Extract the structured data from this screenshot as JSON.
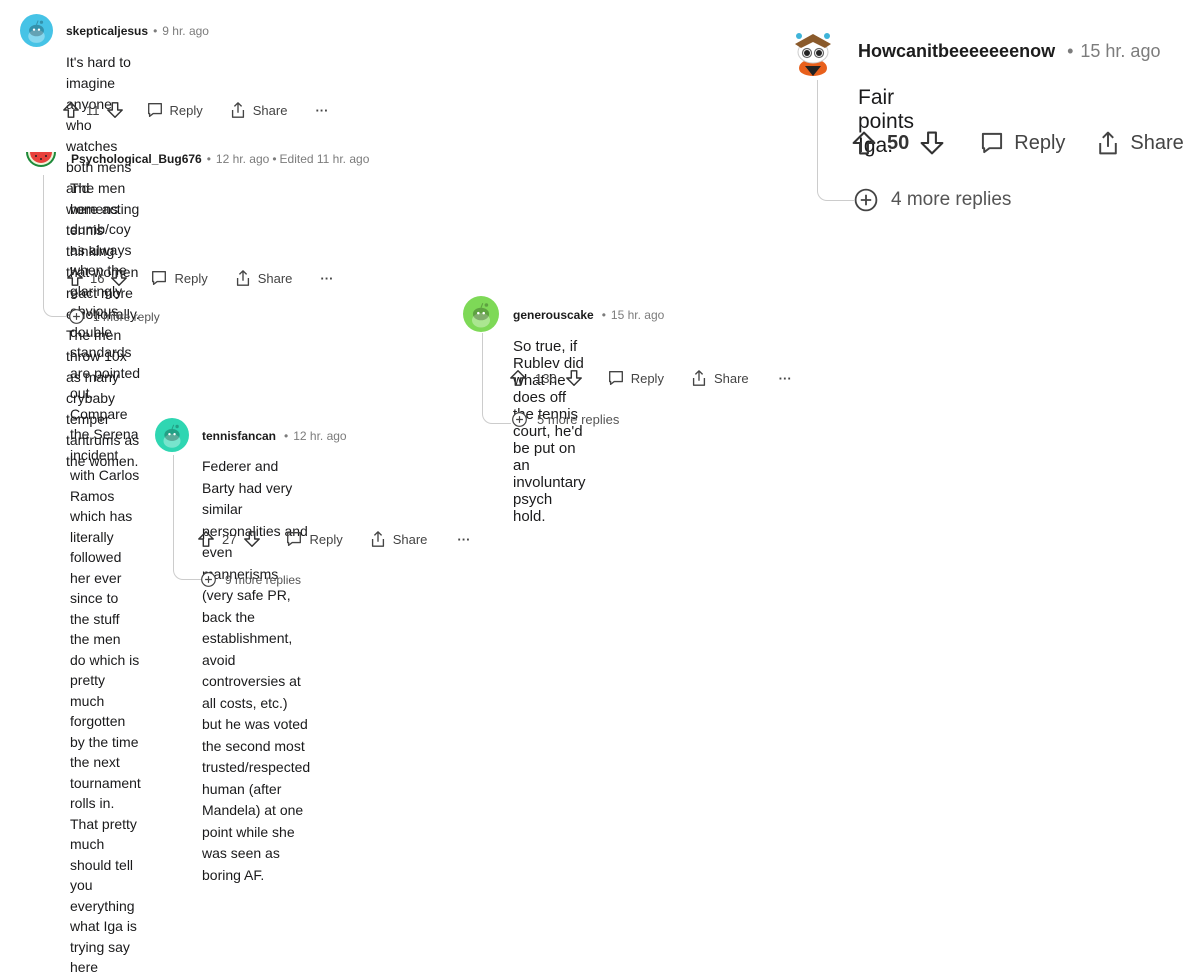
{
  "comments": {
    "c1": {
      "username": "skepticaljesus",
      "time": "9 hr. ago",
      "body_lines": [
        "It's hard to imagine anyone who watches both mens and womens tennis thinking that women react more",
        "emotionally. The men throw 10x as many crybaby temper tantrums as the women."
      ],
      "votes": "11",
      "reply_label": "Reply",
      "share_label": "Share",
      "more_label": "···",
      "avatar_color": "#46c3e6"
    },
    "c2": {
      "username": "Psychological_Bug676",
      "time": "12 hr. ago",
      "edited": "Edited 11 hr. ago",
      "body_lines": [
        "The men here acting dumb/coy as always when the glaringly obvious double standards are pointed out.",
        "Compare the Serena incident with Carlos Ramos which has literally followed her ever since to the stuff the men",
        "do which is pretty much forgotten by the time the next tournament rolls in. That pretty much should tell you",
        "everything what Iga is trying say here"
      ],
      "votes": "16",
      "reply_label": "Reply",
      "share_label": "Share",
      "more_label": "···",
      "more_replies": "1 more reply"
    },
    "c3": {
      "username": "Howcanitbeeeeeeenow",
      "time": "15 hr. ago",
      "body": "Fair points Iga.",
      "votes": "50",
      "reply_label": "Reply",
      "share_label": "Share",
      "more_replies": "4 more replies"
    },
    "c4": {
      "username": "generouscake",
      "time": "15 hr. ago",
      "body": "So true, if Rublev did what he does off the tennis court, he'd be put on an involuntary psych hold.",
      "votes": "130",
      "reply_label": "Reply",
      "share_label": "Share",
      "more_label": "···",
      "more_replies": "5 more replies",
      "avatar_color": "#7ed957"
    },
    "c5": {
      "username": "tennisfancan",
      "time": "12 hr. ago",
      "body_lines": [
        "Federer and Barty had very similar personalities and even mannerisms (very safe PR, back the",
        "establishment, avoid controversies at all costs, etc.) but he was voted the second most trusted/respected",
        "human (after Mandela) at one point while she was seen as boring AF."
      ],
      "votes": "27",
      "reply_label": "Reply",
      "share_label": "Share",
      "more_label": "···",
      "more_replies": "9 more replies",
      "avatar_color": "#2fd6b2"
    }
  }
}
